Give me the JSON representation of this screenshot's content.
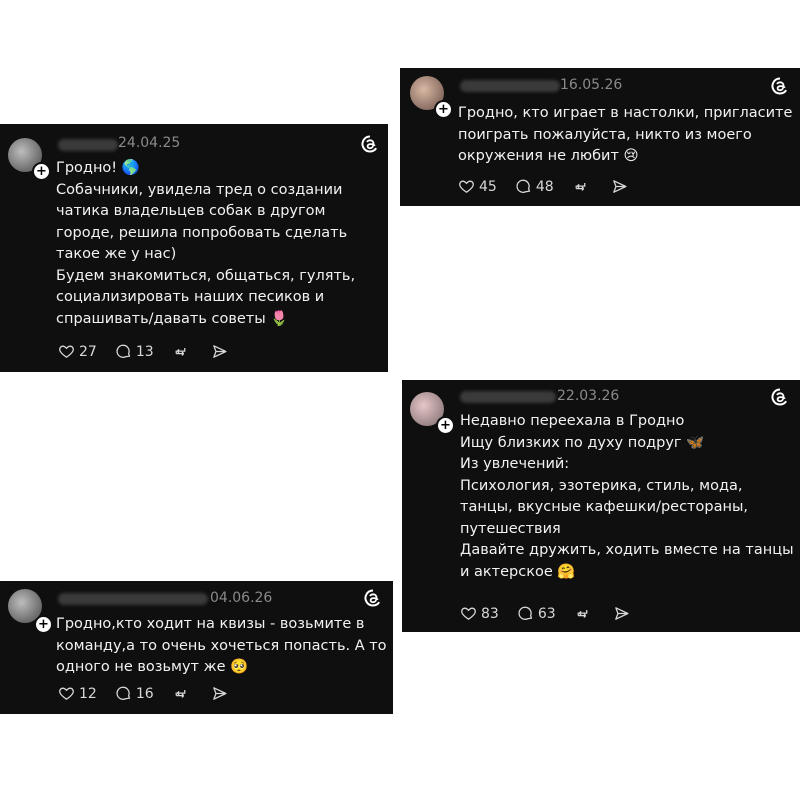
{
  "posts": [
    {
      "id": "post1",
      "date": "24.04.25",
      "lines": [
        "Гродно! 🌎",
        "Собачники, увидела  тред о создании",
        "чатика владельцев собак в другом",
        "городе, решила попробовать сделать",
        "такое же у нас)",
        "Будем знакомиться, общаться, гулять,",
        "социализировать наших песиков и",
        "спрашивать/давать советы 🌷"
      ],
      "likes": "27",
      "replies": "13"
    },
    {
      "id": "post2",
      "date": "16.05.26",
      "lines": [
        "Гродно, кто играет в настолки, пригласите",
        "поиграть пожалуйста, никто из моего",
        "окружения не любит 😢"
      ],
      "likes": "45",
      "replies": "48"
    },
    {
      "id": "post3",
      "date": "22.03.26",
      "lines": [
        "Недавно переехала в Гродно",
        "Ищу близких по духу подруг 🦋",
        "Из увлечений:",
        "Психология, эзотерика, стиль, мода,",
        "танцы, вкусные кафешки/рестораны,",
        "путешествия",
        "Давайте дружить, ходить вместе на танцы",
        "и актерское 🤗"
      ],
      "likes": "83",
      "replies": "63"
    },
    {
      "id": "post4",
      "date": "04.06.26",
      "lines": [
        "Гродно,кто ходит на квизы - возьмите в",
        "команду,а то очень хочеться попасть. А то",
        "одного не возьмут же 🥺"
      ],
      "likes": "12",
      "replies": "16"
    }
  ],
  "icons": {
    "like": "heart-icon",
    "reply": "comment-icon",
    "repost": "repost-icon",
    "share": "share-icon",
    "brand": "threads-logo-icon",
    "follow": "plus-icon"
  }
}
